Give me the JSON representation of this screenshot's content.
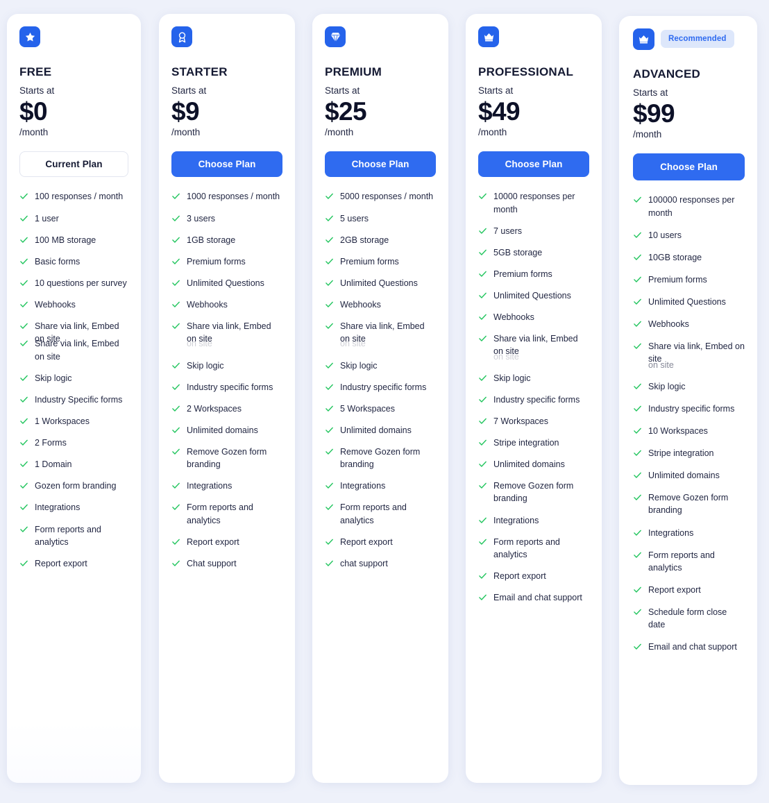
{
  "theme": {
    "page_background": "#eef1fa",
    "card_background": "#ffffff",
    "accent": "#2f6bf0",
    "icon_tile": "#2563eb",
    "check_green": "#22c55e",
    "text_dark": "#1f2440",
    "badge_background": "#dde7fb",
    "badge_text": "#2f6bf0"
  },
  "labels": {
    "starts_at": "Starts at",
    "period": "/month",
    "recommended": "Recommended"
  },
  "plans": [
    {
      "name": "FREE",
      "icon": "star-icon",
      "starts_at": "Starts at",
      "price": "$0",
      "period": "/month",
      "cta": "Current Plan",
      "cta_style": "outline",
      "badge": null,
      "features": [
        "100 responses / month",
        "1 user",
        "100 MB storage",
        "Basic forms",
        "10 questions per survey",
        "Webhooks",
        "Share via link, Embed on site",
        "Share via link, Embed on site",
        "Skip logic",
        "Industry Specific forms",
        "1 Workspaces",
        "2 Forms",
        "1 Domain",
        "Gozen form branding",
        "Integrations",
        "Form reports and analytics",
        "Report export"
      ]
    },
    {
      "name": "STARTER",
      "icon": "award-ribbon-icon",
      "starts_at": "Starts at",
      "price": "$9",
      "period": "/month",
      "cta": "Choose Plan",
      "cta_style": "primary",
      "badge": null,
      "features": [
        "1000 responses / month",
        "3 users",
        "1GB storage",
        "Premium forms",
        "Unlimited Questions",
        "Webhooks",
        "Share via link, Embed on site",
        "on site",
        "Skip logic",
        "Industry specific forms",
        "2 Workspaces",
        "Unlimited domains",
        "Remove Gozen form branding",
        "Integrations",
        "Form reports and analytics",
        "Report export",
        "Chat support"
      ]
    },
    {
      "name": "PREMIUM",
      "icon": "diamond-icon",
      "starts_at": "Starts at",
      "price": "$25",
      "period": "/month",
      "cta": "Choose Plan",
      "cta_style": "primary",
      "badge": null,
      "features": [
        "5000 responses / month",
        "5 users",
        "2GB storage",
        "Premium forms",
        "Unlimited Questions",
        "Webhooks",
        "Share via link, Embed on site",
        "on site",
        "Skip logic",
        "Industry specific forms",
        "5 Workspaces",
        "Unlimited domains",
        "Remove Gozen form branding",
        "Integrations",
        "Form reports and analytics",
        "Report export",
        "chat support"
      ]
    },
    {
      "name": "PROFESSIONAL",
      "icon": "crown-icon",
      "starts_at": "Starts at",
      "price": "$49",
      "period": "/month",
      "cta": "Choose Plan",
      "cta_style": "primary",
      "badge": null,
      "features": [
        "10000 responses per month",
        "7 users",
        "5GB storage",
        "Premium forms",
        "Unlimited Questions",
        "Webhooks",
        "Share via link, Embed on site",
        "on site",
        "Skip logic",
        "Industry specific forms",
        "7 Workspaces",
        "Stripe integration",
        "Unlimited domains",
        "Remove Gozen form branding",
        "Integrations",
        "Form reports and analytics",
        "Report export",
        "Email and chat support"
      ]
    },
    {
      "name": "ADVANCED",
      "icon": "crown-icon",
      "starts_at": "Starts at",
      "price": "$99",
      "period": "/month",
      "cta": "Choose Plan",
      "cta_style": "primary",
      "badge": "Recommended",
      "features": [
        "100000 responses per month",
        "10 users",
        "10GB storage",
        "Premium forms",
        "Unlimited Questions",
        "Webhooks",
        "Share via link, Embed on site",
        "on site",
        "Skip logic",
        "Industry specific forms",
        "10 Workspaces",
        "Stripe integration",
        "Unlimited domains",
        "Remove Gozen form branding",
        "Integrations",
        "Form reports and analytics",
        "Report export",
        "Schedule form close date",
        "Email and chat support"
      ]
    }
  ]
}
